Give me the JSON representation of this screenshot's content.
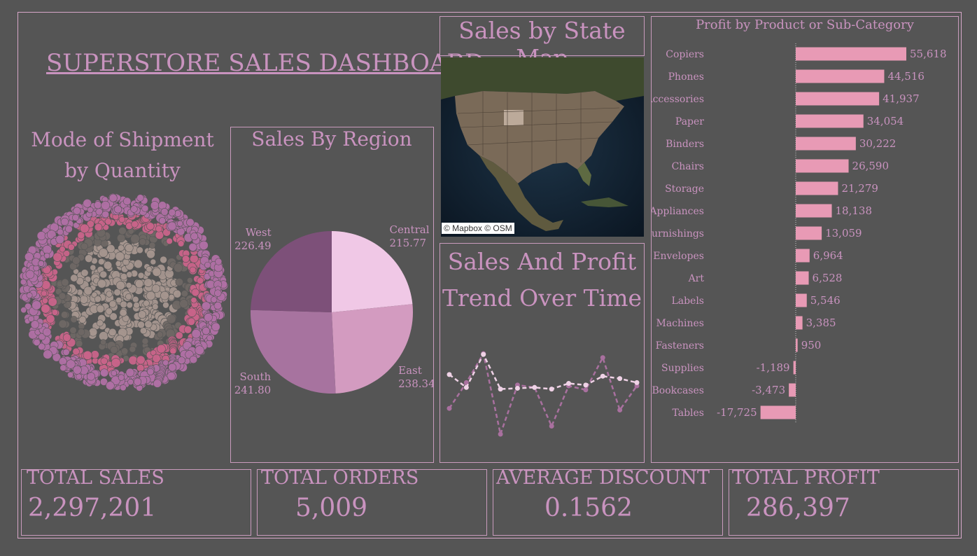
{
  "dashboard": {
    "title": "SUPERSTORE SALES DASHBOARD"
  },
  "shipment": {
    "title_line1": "Mode of Shipment",
    "title_line2": "by Quantity"
  },
  "region": {
    "title": "Sales By Region"
  },
  "map": {
    "title": "Sales by State Map",
    "credit": "© Mapbox © OSM"
  },
  "trend": {
    "title_line1": "Sales And Profit",
    "title_line2": "Trend Over Time"
  },
  "profit_panel": {
    "title": "Profit by Product or Sub-Category"
  },
  "kpis": [
    {
      "label": "TOTAL SALES",
      "value": "2,297,201"
    },
    {
      "label": "TOTAL ORDERS",
      "value": "5,009"
    },
    {
      "label": "AVERAGE DISCOUNT",
      "value": "0.1562"
    },
    {
      "label": "TOTAL PROFIT",
      "value": "286,397"
    }
  ],
  "colors": {
    "background": "#555555",
    "accent_text": "#c993bf",
    "bar": "#e89ab5",
    "pie_central": "#f0c8e6",
    "pie_east": "#d39bc0",
    "pie_south": "#a7739f",
    "pie_west": "#7d5079",
    "ring_inner": "#a6968f",
    "ring_mid_gray": "#6f6865",
    "ring_pink": "#c9648a",
    "ring_outer": "#b070a5"
  },
  "chart_data": [
    {
      "type": "pie",
      "title": "Sales By Region",
      "labels": [
        "Central",
        "East",
        "South",
        "West"
      ],
      "values": [
        215.77,
        238.34,
        241.8,
        226.49
      ],
      "value_labels": [
        "215.77",
        "238.34",
        "241.80",
        "226.49"
      ]
    },
    {
      "type": "bar",
      "title": "Profit by Product or Sub-Category",
      "orientation": "horizontal",
      "categories": [
        "Copiers",
        "Phones",
        "Accessories",
        "Paper",
        "Binders",
        "Chairs",
        "Storage",
        "Appliances",
        "Furnishings",
        "Envelopes",
        "Art",
        "Labels",
        "Machines",
        "Fasteners",
        "Supplies",
        "Bookcases",
        "Tables"
      ],
      "values": [
        55618,
        44516,
        41937,
        34054,
        30222,
        26590,
        21279,
        18138,
        13059,
        6964,
        6528,
        5546,
        3385,
        950,
        -1189,
        -3473,
        -17725
      ],
      "value_labels": [
        "55,618",
        "44,516",
        "41,937",
        "34,054",
        "30,222",
        "26,590",
        "21,279",
        "18,138",
        "13,059",
        "6,964",
        "6,528",
        "5,546",
        "3,385",
        "950",
        "-1,189",
        "-3,473",
        "-17,725"
      ]
    },
    {
      "type": "line",
      "title": "Sales And Profit Trend Over Time",
      "x": [
        1,
        2,
        3,
        4,
        5,
        6,
        7,
        8,
        9,
        10,
        11,
        12
      ],
      "series": [
        {
          "values": [
            0.74,
            0.58,
            0.99,
            0.56,
            0.57,
            0.58,
            0.56,
            0.63,
            0.61,
            0.72,
            0.69,
            0.64
          ]
        },
        {
          "values": [
            0.32,
            0.64,
            1.0,
            0.0,
            0.61,
            0.58,
            0.1,
            0.6,
            0.55,
            0.95,
            0.3,
            0.6
          ]
        }
      ]
    },
    {
      "type": "scatter",
      "title": "Mode of Shipment by Quantity",
      "ring_categories": [
        "inner",
        "gray band",
        "pink band",
        "outer band"
      ],
      "ring_counts": [
        300,
        140,
        280,
        640
      ]
    }
  ]
}
